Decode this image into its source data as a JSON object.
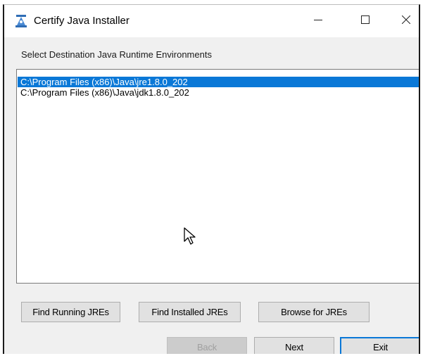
{
  "window": {
    "title": "Certify Java Installer",
    "title_icon": "installer-icon",
    "controls": [
      "minimize-icon",
      "maximize-icon",
      "close-icon"
    ]
  },
  "instruction": "Select Destination Java Runtime Environments",
  "jre_list": {
    "items": [
      {
        "label": "C:\\Program Files (x86)\\Java\\jre1.8.0_202",
        "selected": true
      },
      {
        "label": "C:\\Program Files (x86)\\Java\\jdk1.8.0_202",
        "selected": false
      }
    ]
  },
  "buttons": {
    "find_running": "Find Running JREs",
    "find_installed": "Find Installed JREs",
    "browse": "Browse for JREs",
    "back": "Back",
    "next": "Next",
    "exit": "Exit"
  },
  "button_states": {
    "back_enabled": false,
    "default_button": "exit"
  },
  "colors": {
    "selection": "#0a78d7",
    "default_button_border": "#0a78d7"
  },
  "cursor": "arrow-cursor-icon"
}
